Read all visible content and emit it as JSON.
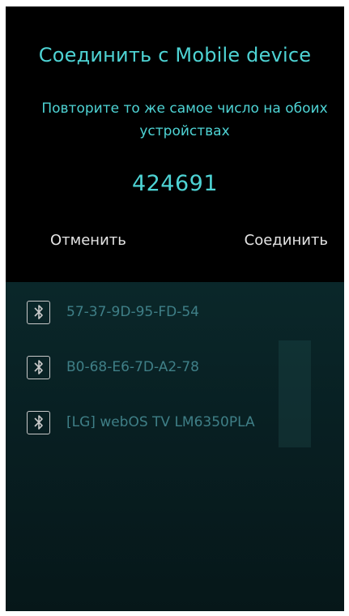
{
  "dialog": {
    "title": "Соединить с Mobile device",
    "subtitle": "Повторите то же самое число на обоих устройствах",
    "passkey": "424691",
    "cancel_label": "Отменить",
    "connect_label": "Соединить"
  },
  "devices": [
    {
      "name": "57-37-9D-95-FD-54",
      "icon": "bluetooth-icon"
    },
    {
      "name": "B0-68-E6-7D-A2-78",
      "icon": "bluetooth-icon"
    },
    {
      "name": "[LG] webOS TV LM6350PLA",
      "icon": "bluetooth-icon"
    }
  ],
  "colors": {
    "accent": "#4ed3d4",
    "dialog_bg": "#000000",
    "list_bg": "#0d3132",
    "device_text": "#3f7f87",
    "button_text": "#e4e4e4"
  }
}
